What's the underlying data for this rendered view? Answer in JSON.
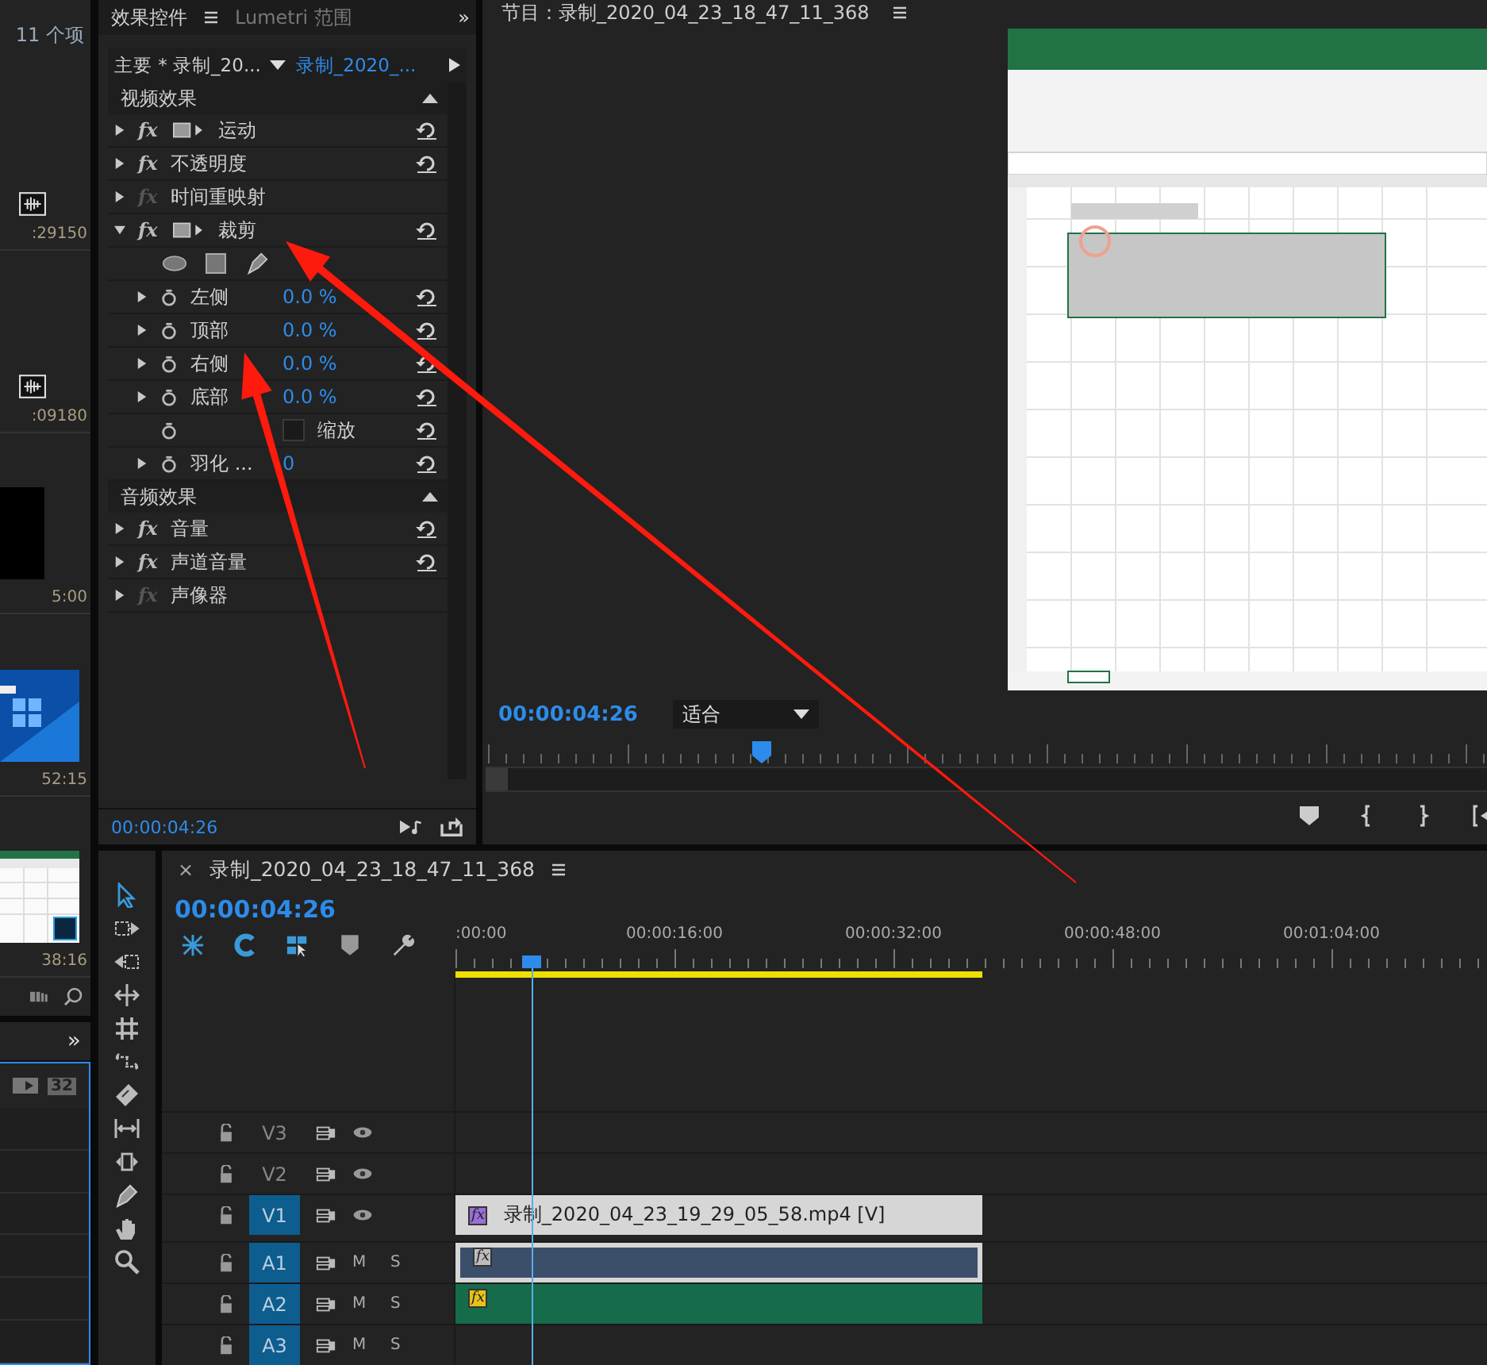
{
  "project_panel": {
    "item_count": "11 个项",
    "items": [
      {
        "kind": "audio",
        "duration": ":29150"
      },
      {
        "kind": "audio",
        "duration": ":09180"
      },
      {
        "kind": "picture",
        "duration": "5:00"
      },
      {
        "kind": "picture",
        "duration": "52:15"
      },
      {
        "kind": "picture",
        "duration": "38:16"
      }
    ]
  },
  "media_panel": {
    "overflow": "»",
    "badge": "32"
  },
  "effect_controls": {
    "tabs": [
      {
        "label": "效果控件",
        "selected": true
      },
      {
        "label": "Lumetri 范围",
        "selected": false
      }
    ],
    "overflow": "»",
    "master": "主要 * 录制_20...",
    "clip": "录制_2020_...",
    "sections": [
      {
        "title": "视频效果",
        "rows": [
          {
            "name": "运动",
            "fx": "fx",
            "fx_enabled": true,
            "transform": true,
            "expanded": false,
            "resettable": true
          },
          {
            "name": "不透明度",
            "fx": "fx",
            "fx_enabled": true,
            "transform": false,
            "expanded": false,
            "resettable": true
          },
          {
            "name": "时间重映射",
            "fx": "fx",
            "fx_enabled": false,
            "transform": false,
            "expanded": false,
            "resettable": false
          },
          {
            "name": "裁剪",
            "fx": "fx",
            "fx_enabled": true,
            "transform": true,
            "expanded": true,
            "resettable": true,
            "children": [
              {
                "kind": "masks"
              },
              {
                "kind": "property",
                "name": "左侧",
                "value": "0.0 %",
                "expandable": true,
                "resettable": true
              },
              {
                "kind": "property",
                "name": "顶部",
                "value": "0.0 %",
                "expandable": true,
                "resettable": true
              },
              {
                "kind": "property",
                "name": "右侧",
                "value": "0.0 %",
                "expandable": true,
                "resettable": true
              },
              {
                "kind": "property",
                "name": "底部",
                "value": "0.0 %",
                "expandable": true,
                "resettable": true
              },
              {
                "kind": "checkbox",
                "name": "缩放",
                "checked": false,
                "resettable": true
              },
              {
                "kind": "property",
                "name": "羽化 ...",
                "value": "0",
                "expandable": true,
                "resettable": true
              }
            ]
          }
        ]
      },
      {
        "title": "音频效果",
        "rows": [
          {
            "name": "音量",
            "fx": "fx",
            "fx_enabled": true,
            "transform": false,
            "expanded": false,
            "resettable": true
          },
          {
            "name": "声道音量",
            "fx": "fx",
            "fx_enabled": true,
            "transform": false,
            "expanded": false,
            "resettable": true
          },
          {
            "name": "声像器",
            "fx": "fx",
            "fx_enabled": false,
            "transform": false,
            "expanded": false,
            "resettable": false
          }
        ]
      }
    ],
    "timecode": "00:00:04:26"
  },
  "program_monitor": {
    "title": "节目：录制_2020_04_23_18_47_11_368",
    "timecode": "00:00:04:26",
    "zoom": "适合"
  },
  "timeline": {
    "close": "×",
    "sequence": "录制_2020_04_23_18_47_11_368",
    "timecode": "00:00:04:26",
    "ruler": [
      ":00:00",
      "00:00:16:00",
      "00:00:32:00",
      "00:00:48:00",
      "00:01:04:00"
    ],
    "tracks": [
      {
        "kind": "video",
        "label": "V3",
        "targeted": false
      },
      {
        "kind": "video",
        "label": "V2",
        "targeted": false
      },
      {
        "kind": "video",
        "label": "V1",
        "targeted": true,
        "clip": {
          "name": "录制_2020_04_23_19_29_05_58.mp4 [V]",
          "fx": "fx",
          "color": "#9a6fd6",
          "selected": true
        }
      },
      {
        "kind": "audio",
        "label": "A1",
        "targeted": true,
        "mute": "M",
        "solo": "S",
        "clip": {
          "fx": "fx",
          "color": "#bdbdbd",
          "selected": true
        }
      },
      {
        "kind": "audio",
        "label": "A2",
        "targeted": true,
        "mute": "M",
        "solo": "S",
        "clip": {
          "fx": "fx",
          "color": "#e8c21c",
          "selected": false
        }
      },
      {
        "kind": "audio",
        "label": "A3",
        "targeted": true,
        "mute": "M",
        "solo": "S"
      }
    ]
  }
}
